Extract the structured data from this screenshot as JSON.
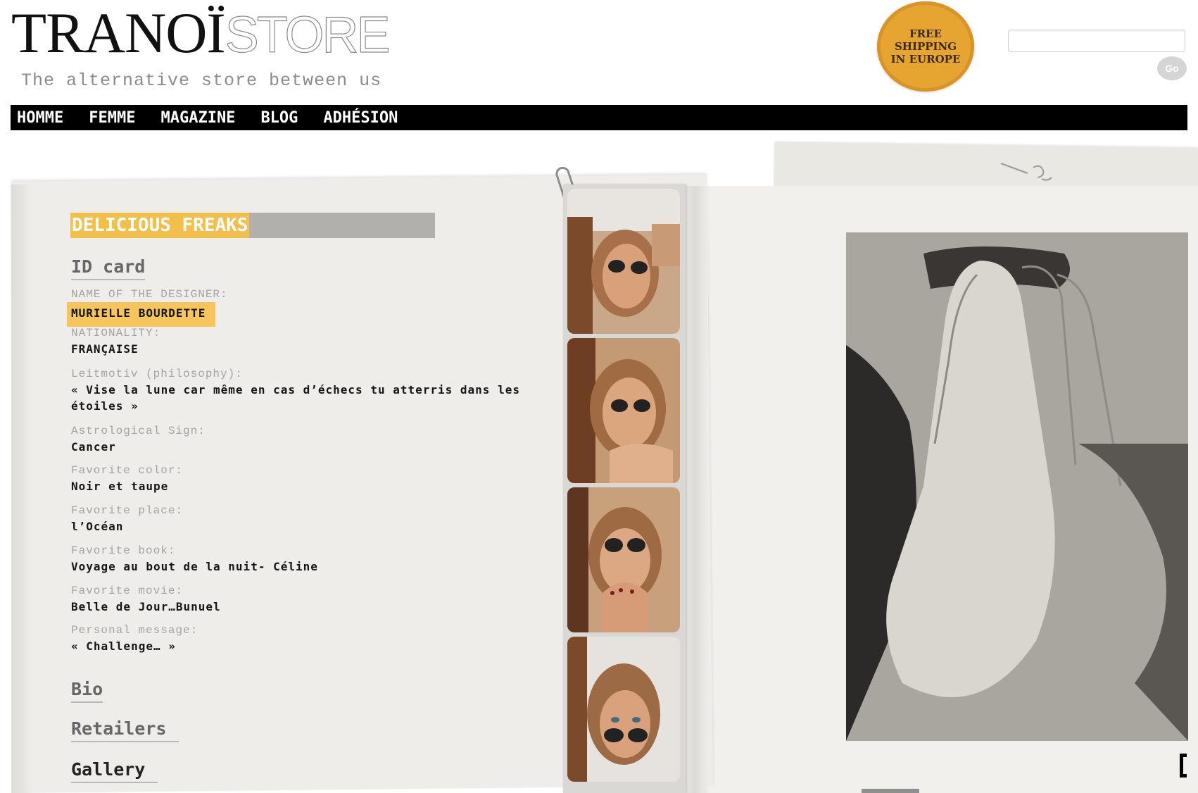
{
  "header": {
    "logo_main": "TRANOÏ",
    "logo_sub": "STORE",
    "tagline": "The alternative store between us",
    "badge_lines": [
      "FREE",
      "SHIPPING",
      "IN EUROPE"
    ],
    "search_placeholder": "",
    "search_button_label": "Go"
  },
  "nav": {
    "items": [
      "HOMME",
      "FEMME",
      "MAGAZINE",
      "BLOG",
      "ADHÉSION"
    ]
  },
  "profile": {
    "section_title": "DELICIOUS FREAKS",
    "id_card_heading": "ID card",
    "fields": [
      {
        "label": "NAME OF THE DESIGNER:",
        "value": "MURIELLE BOURDETTE"
      },
      {
        "label": "NATIONALITY:",
        "value": "FRANÇAISE"
      },
      {
        "label": "Leitmotiv (philosophy):",
        "value": "« Vise la lune car même en cas d’échecs tu atterris dans les étoiles »"
      },
      {
        "label": "Astrological Sign:",
        "value": "Cancer"
      },
      {
        "label": "Favorite color:",
        "value": "Noir et taupe"
      },
      {
        "label": "Favorite place:",
        "value": "l’Océan"
      },
      {
        "label": "Favorite book:",
        "value": "Voyage au bout de la nuit- Céline"
      },
      {
        "label": "Favorite movie:",
        "value": "Belle de Jour…Bunuel"
      },
      {
        "label": "Personal message:",
        "value": "« Challenge… »"
      }
    ],
    "links": [
      "Bio",
      "Retailers",
      "Gallery"
    ]
  },
  "colors": {
    "accent": "#f1bf4a",
    "badge": "#e6a431",
    "navbar": "#000000",
    "paper": "#eeedea"
  }
}
